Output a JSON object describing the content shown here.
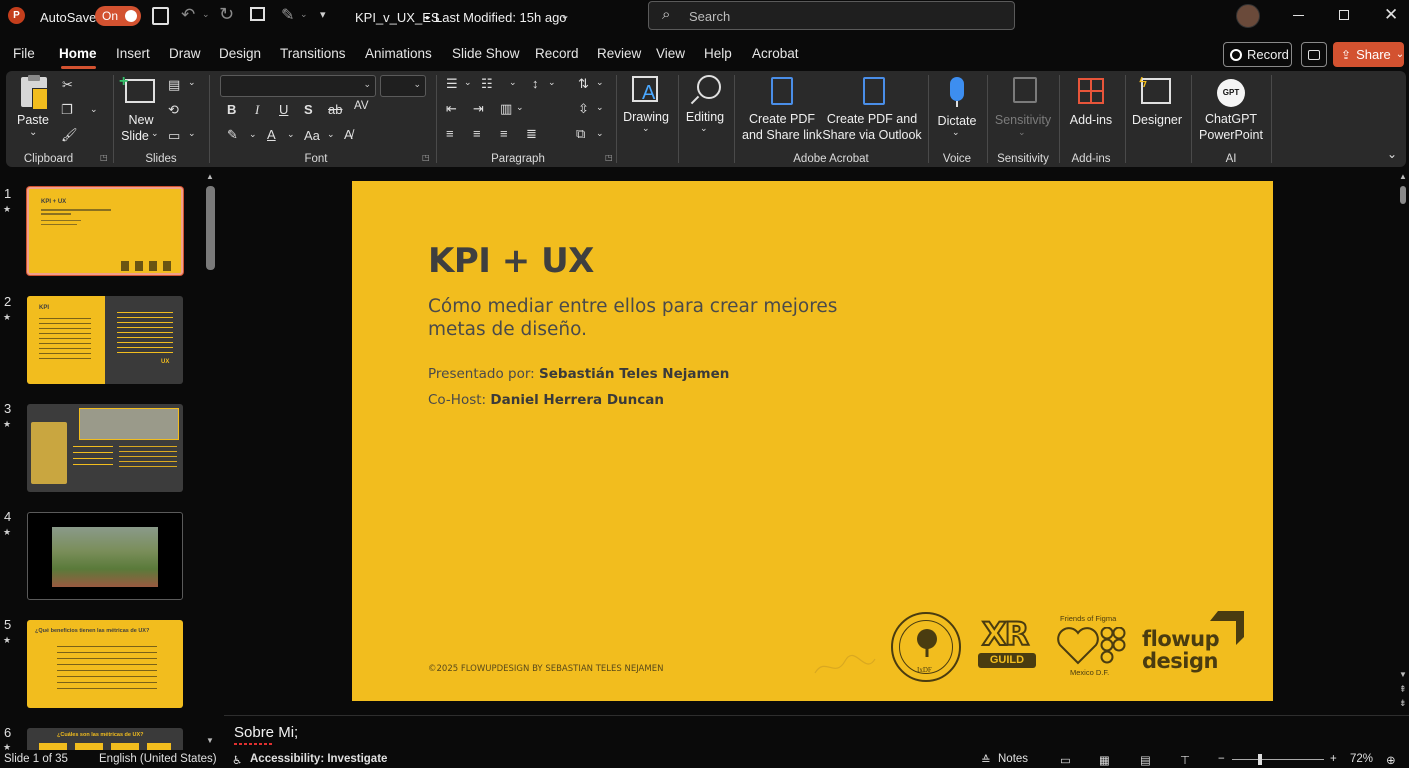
{
  "titlebar": {
    "app_icon": "powerpoint-icon",
    "autosave_label": "AutoSave",
    "autosave_state": "On",
    "document_title": "KPI_v_UX_ES",
    "modified": "Last Modified: 15h ago",
    "search_placeholder": "Search"
  },
  "menu": {
    "items": [
      "File",
      "Home",
      "Insert",
      "Draw",
      "Design",
      "Transitions",
      "Animations",
      "Slide Show",
      "Record",
      "Review",
      "View",
      "Help",
      "Acrobat"
    ],
    "active": "Home",
    "record_button": "Record",
    "share_button": "Share"
  },
  "ribbon": {
    "clipboard": {
      "paste": "Paste",
      "group": "Clipboard"
    },
    "slides": {
      "new_slide_1": "New",
      "new_slide_2": "Slide",
      "group": "Slides"
    },
    "font": {
      "group": "Font",
      "bold": "B",
      "italic": "I",
      "underline": "U",
      "strike": "S",
      "abc": "ab",
      "av": "AV",
      "aa": "Aa"
    },
    "paragraph": {
      "group": "Paragraph"
    },
    "drawing": "Drawing",
    "editing": "Editing",
    "acrobat": {
      "create_pdf_1": "Create PDF",
      "create_pdf_2": "and Share link",
      "outlook_1": "Create PDF and",
      "outlook_2": "Share via Outlook",
      "group": "Adobe Acrobat"
    },
    "voice": {
      "dictate": "Dictate",
      "group": "Voice"
    },
    "sensitivity": {
      "label": "Sensitivity",
      "group": "Sensitivity"
    },
    "addins": {
      "label": "Add-ins",
      "group": "Add-ins"
    },
    "designer": "Designer",
    "ai": {
      "chatgpt_1": "ChatGPT",
      "chatgpt_2": "PowerPoint",
      "group": "AI",
      "badge": "GPT"
    }
  },
  "thumbnails": [
    {
      "num": "1",
      "title": "KPI + UX"
    },
    {
      "num": "2",
      "title": "KPI",
      "right_title": "UX"
    },
    {
      "num": "3",
      "title": ""
    },
    {
      "num": "4",
      "title": ""
    },
    {
      "num": "5",
      "title": "¿Qué beneficios tienen las métricas de UX?"
    },
    {
      "num": "6",
      "title": "¿Cuáles son las métricas de UX?"
    }
  ],
  "slide": {
    "title": "KPI + UX",
    "subtitle": "Cómo mediar entre ellos para crear mejores metas de diseño.",
    "presenter_label": "Presentado por: ",
    "presenter_name": "Sebastián Teles Nejamen",
    "cohost_label": "Co-Host: ",
    "cohost_name": "Daniel Herrera Duncan",
    "footer": "©2025 FLOWUPDESIGN BY SEBASTIAN TELES NEJAMEN",
    "logos": {
      "ixdf_bottom": "IxDF",
      "xr_1": "XR",
      "xr_2": "GUILD",
      "figma_top": "Friends of Figma",
      "figma_bottom": "Mexico D.F.",
      "flowup_1": "flowup",
      "flowup_2": "design"
    }
  },
  "notes": {
    "text": "Sobre Mi;"
  },
  "status": {
    "slide": "Slide 1 of 35",
    "language": "English (United States)",
    "accessibility": "Accessibility: Investigate",
    "notes": "Notes",
    "zoom": "72%"
  },
  "colors": {
    "accent": "#d35230",
    "slide_bg": "#f2bd1e",
    "text_dark": "#3f3f3f"
  }
}
